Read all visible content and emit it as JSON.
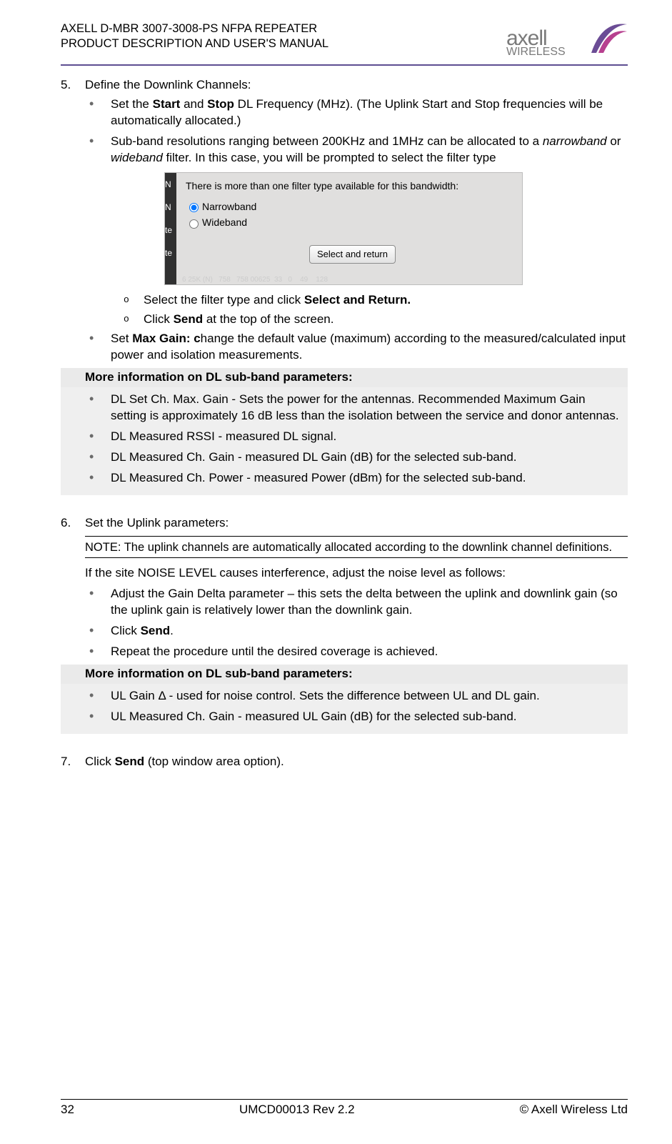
{
  "header": {
    "line1": "AXELL D-MBR 3007-3008-PS NFPA REPEATER",
    "line2": "PRODUCT DESCRIPTION AND USER'S MANUAL",
    "logo_word": "axell",
    "logo_sub": "WIRELESS"
  },
  "step5": {
    "num": "5.",
    "title": "Define the Downlink Channels:",
    "b1_pre": "Set the ",
    "b1_s1": "Start",
    "b1_mid": " and ",
    "b1_s2": "Stop",
    "b1_post": " DL Frequency (MHz). (The Uplink Start and Stop frequencies will be automatically allocated.)",
    "b2_pre": "Sub-band resolutions ranging between 200KHz and 1MHz can be allocated to a ",
    "b2_i1": "narrowband",
    "b2_mid": " or ",
    "b2_i2": "wideband",
    "b2_post": " filter. In this case, you will be prompted to select the filter type",
    "sub1_pre": "Select the filter type and click ",
    "sub1_b": "Select and Return.",
    "sub2_pre": "Click ",
    "sub2_b": "Send",
    "sub2_post": " at the top of the screen.",
    "b3_pre": "Set ",
    "b3_b": "Max Gain: c",
    "b3_post": "hange the default value (maximum) according to the measured/calculated input power and isolation measurements.",
    "more_hdr": "More information on DL sub-band parameters:",
    "more1": "DL Set Ch. Max. Gain - Sets the power for the antennas. Recommended Maximum Gain setting is approximately 16 dB less than the isolation between the service and donor antennas.",
    "more2": "DL Measured RSSI - measured DL signal.",
    "more3": "DL Measured Ch. Gain - measured DL Gain (dB) for the selected sub-band.",
    "more4": "DL Measured Ch. Power - measured Power (dBm) for the selected sub-band."
  },
  "dialog": {
    "title": "There is more than one filter type available for this bandwidth:",
    "opt1": "Narrowband",
    "opt2": "Wideband",
    "btn": "Select and return"
  },
  "step6": {
    "num": "6.",
    "title": "Set the Uplink parameters:",
    "note": "NOTE: The uplink channels are automatically allocated according to the downlink channel definitions.",
    "intro": "If the site NOISE LEVEL causes interference, adjust the noise level as follows:",
    "b1": "Adjust the Gain Delta parameter – this sets the delta between the uplink and downlink gain (so the uplink gain is relatively lower than the downlink gain.",
    "b2_pre": "Click ",
    "b2_b": "Send",
    "b2_post": ".",
    "b3": "Repeat the procedure until the desired coverage is achieved.",
    "more_hdr": "More information on DL sub-band parameters:",
    "more1": "UL Gain Δ - used for noise control. Sets the difference between UL and DL gain.",
    "more2": "UL Measured Ch. Gain - measured UL Gain (dB) for the selected sub-band."
  },
  "step7": {
    "num": "7.",
    "pre": "Click ",
    "b": "Send",
    "post": " (top window area option)."
  },
  "footer": {
    "left": "32",
    "center": "UMCD00013 Rev 2.2",
    "right": "© Axell Wireless Ltd"
  }
}
